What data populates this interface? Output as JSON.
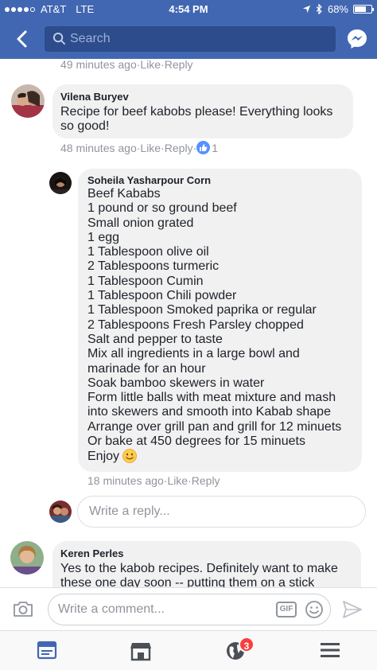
{
  "status_bar": {
    "carrier": "AT&T",
    "network": "LTE",
    "time": "4:54 PM",
    "battery": "68%",
    "battery_level": 0.68
  },
  "nav": {
    "search_placeholder": "Search"
  },
  "top_meta": {
    "time": "49 minutes ago",
    "like": "Like",
    "reply": "Reply",
    "sep": " · "
  },
  "comments": [
    {
      "author": "Vilena Buryev",
      "text": "Recipe for beef kabobs please! Everything looks so good!",
      "time": "48 minutes ago",
      "like": "Like",
      "reply": "Reply",
      "reactions": "1"
    },
    {
      "author": "Soheila Yasharpour Corn",
      "text": "Beef Kababs\n1 pound or so ground beef\nSmall onion grated\n1 egg\n1 Tablespoon olive oil\n2 Tablespoons turmeric\n1 Tablespoon Cumin\n1 Tablespoon Chili powder\n1 Tablespoon Smoked paprika or regular\n2 Tablespoons Fresh Parsley chopped\nSalt and pepper to taste\nMix all ingredients in a large bowl and marinade for an hour\nSoak bamboo skewers in water\nForm little balls with meat mixture and mash into skewers and smooth into Kabab shape\nArrange over grill pan and grill for 12 minuets\nOr  bake at 450 degrees for 15 minuets\nEnjoy",
      "time": "18 minutes ago",
      "like": "Like",
      "reply": "Reply"
    },
    {
      "author": "Keren Perles",
      "text": "Yes to the kabob recipes. Definitely want to make these one day soon -- putting them on a stick"
    }
  ],
  "reply_field": {
    "placeholder": "Write a reply..."
  },
  "composer": {
    "placeholder": "Write a comment...",
    "gif": "GIF"
  },
  "tab_bar": {
    "notifications_count": "3"
  },
  "colors": {
    "brand": "#4267b2",
    "bubble": "#f1f1f1",
    "meta": "#90949c",
    "like_blue": "#5890ff",
    "badge_red": "#fa3e3e"
  }
}
